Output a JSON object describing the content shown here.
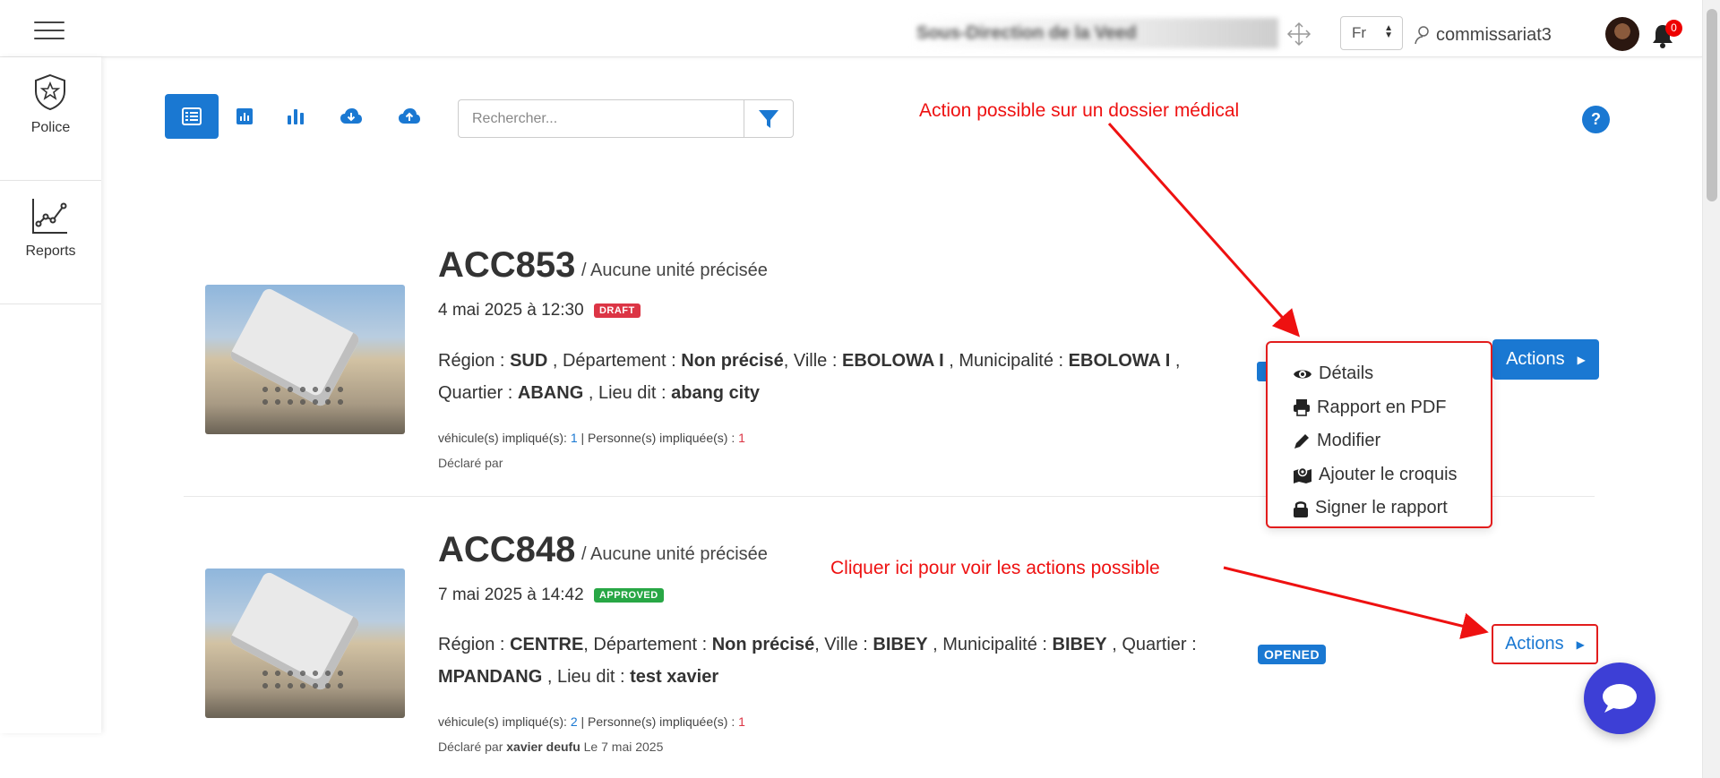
{
  "header": {
    "org_name": "Sous-Direction de la Veed",
    "language": "Fr",
    "username": "commissariat3",
    "notification_count": "0"
  },
  "sidebar": {
    "items": [
      {
        "label": "Police",
        "icon": "police-badge-icon"
      },
      {
        "label": "Reports",
        "icon": "line-chart-icon"
      }
    ]
  },
  "toolbar": {
    "buttons": [
      {
        "name": "list-view",
        "icon": "list-icon",
        "active": true
      },
      {
        "name": "bar-chart",
        "icon": "bar-chart-small-icon"
      },
      {
        "name": "column-chart",
        "icon": "bar-chart-icon"
      },
      {
        "name": "download",
        "icon": "cloud-download-icon"
      },
      {
        "name": "upload",
        "icon": "cloud-upload-icon"
      }
    ],
    "search_placeholder": "Rechercher...",
    "help_label": "?"
  },
  "annotations": {
    "top": "Action possible sur un dossier médical",
    "bottom": "Cliquer ici pour voir les actions possible"
  },
  "records": [
    {
      "code": "ACC853",
      "unit": "/ Aucune unité précisée",
      "date": "4 mai 2025 à 12:30",
      "status": "DRAFT",
      "location": {
        "region_label": "Région :",
        "region": "SUD",
        "dept_label": ", Département :",
        "dept": "Non précisé",
        "ville_label": ", Ville :",
        "ville": "EBOLOWA I",
        "muni_label": ", Municipalité :",
        "muni": "EBOLOWA I",
        "quartier_label": ", Quartier :",
        "quartier": "ABANG",
        "lieu_label": ", Lieu dit :",
        "lieu": "abang city"
      },
      "vehicles_label": "véhicule(s) impliqué(s):",
      "vehicles": "1",
      "persons_label": "| Personne(s) impliquée(s) :",
      "persons": "1",
      "declared_label": "Déclaré par",
      "declared_by": "",
      "declared_date": "",
      "actions_label": "Actions"
    },
    {
      "code": "ACC848",
      "unit": "/ Aucune unité précisée",
      "date": "7 mai 2025 à 14:42",
      "status": "APPROVED",
      "workflow_status": "OPENED",
      "location": {
        "region_label": "Région :",
        "region": "CENTRE",
        "dept_label": ", Département :",
        "dept": "Non précisé",
        "ville_label": ", Ville :",
        "ville": "BIBEY",
        "muni_label": ", Municipalité :",
        "muni": "BIBEY",
        "quartier_label": ", Quartier :",
        "quartier": "MPANDANG",
        "lieu_label": ", Lieu dit :",
        "lieu": "test xavier"
      },
      "vehicles_label": "véhicule(s) impliqué(s):",
      "vehicles": "2",
      "persons_label": "| Personne(s) impliquée(s) :",
      "persons": "1",
      "declared_label": "Déclaré par",
      "declared_by": "xavier deufu",
      "declared_date": "Le 7 mai 2025",
      "actions_label": "Actions"
    }
  ],
  "dropdown": {
    "items": [
      {
        "label": "Détails",
        "icon": "eye-icon"
      },
      {
        "label": "Rapport en PDF",
        "icon": "print-icon"
      },
      {
        "label": "Modifier",
        "icon": "pencil-icon"
      },
      {
        "label": "Ajouter le croquis",
        "icon": "map-marker-icon"
      },
      {
        "label": "Signer le rapport",
        "icon": "lock-icon"
      }
    ]
  },
  "colors": {
    "primary": "#1a78d2",
    "annotation": "#ee1111",
    "draft": "#dc3545",
    "approved": "#28a745",
    "chat": "#3d3fd6"
  }
}
